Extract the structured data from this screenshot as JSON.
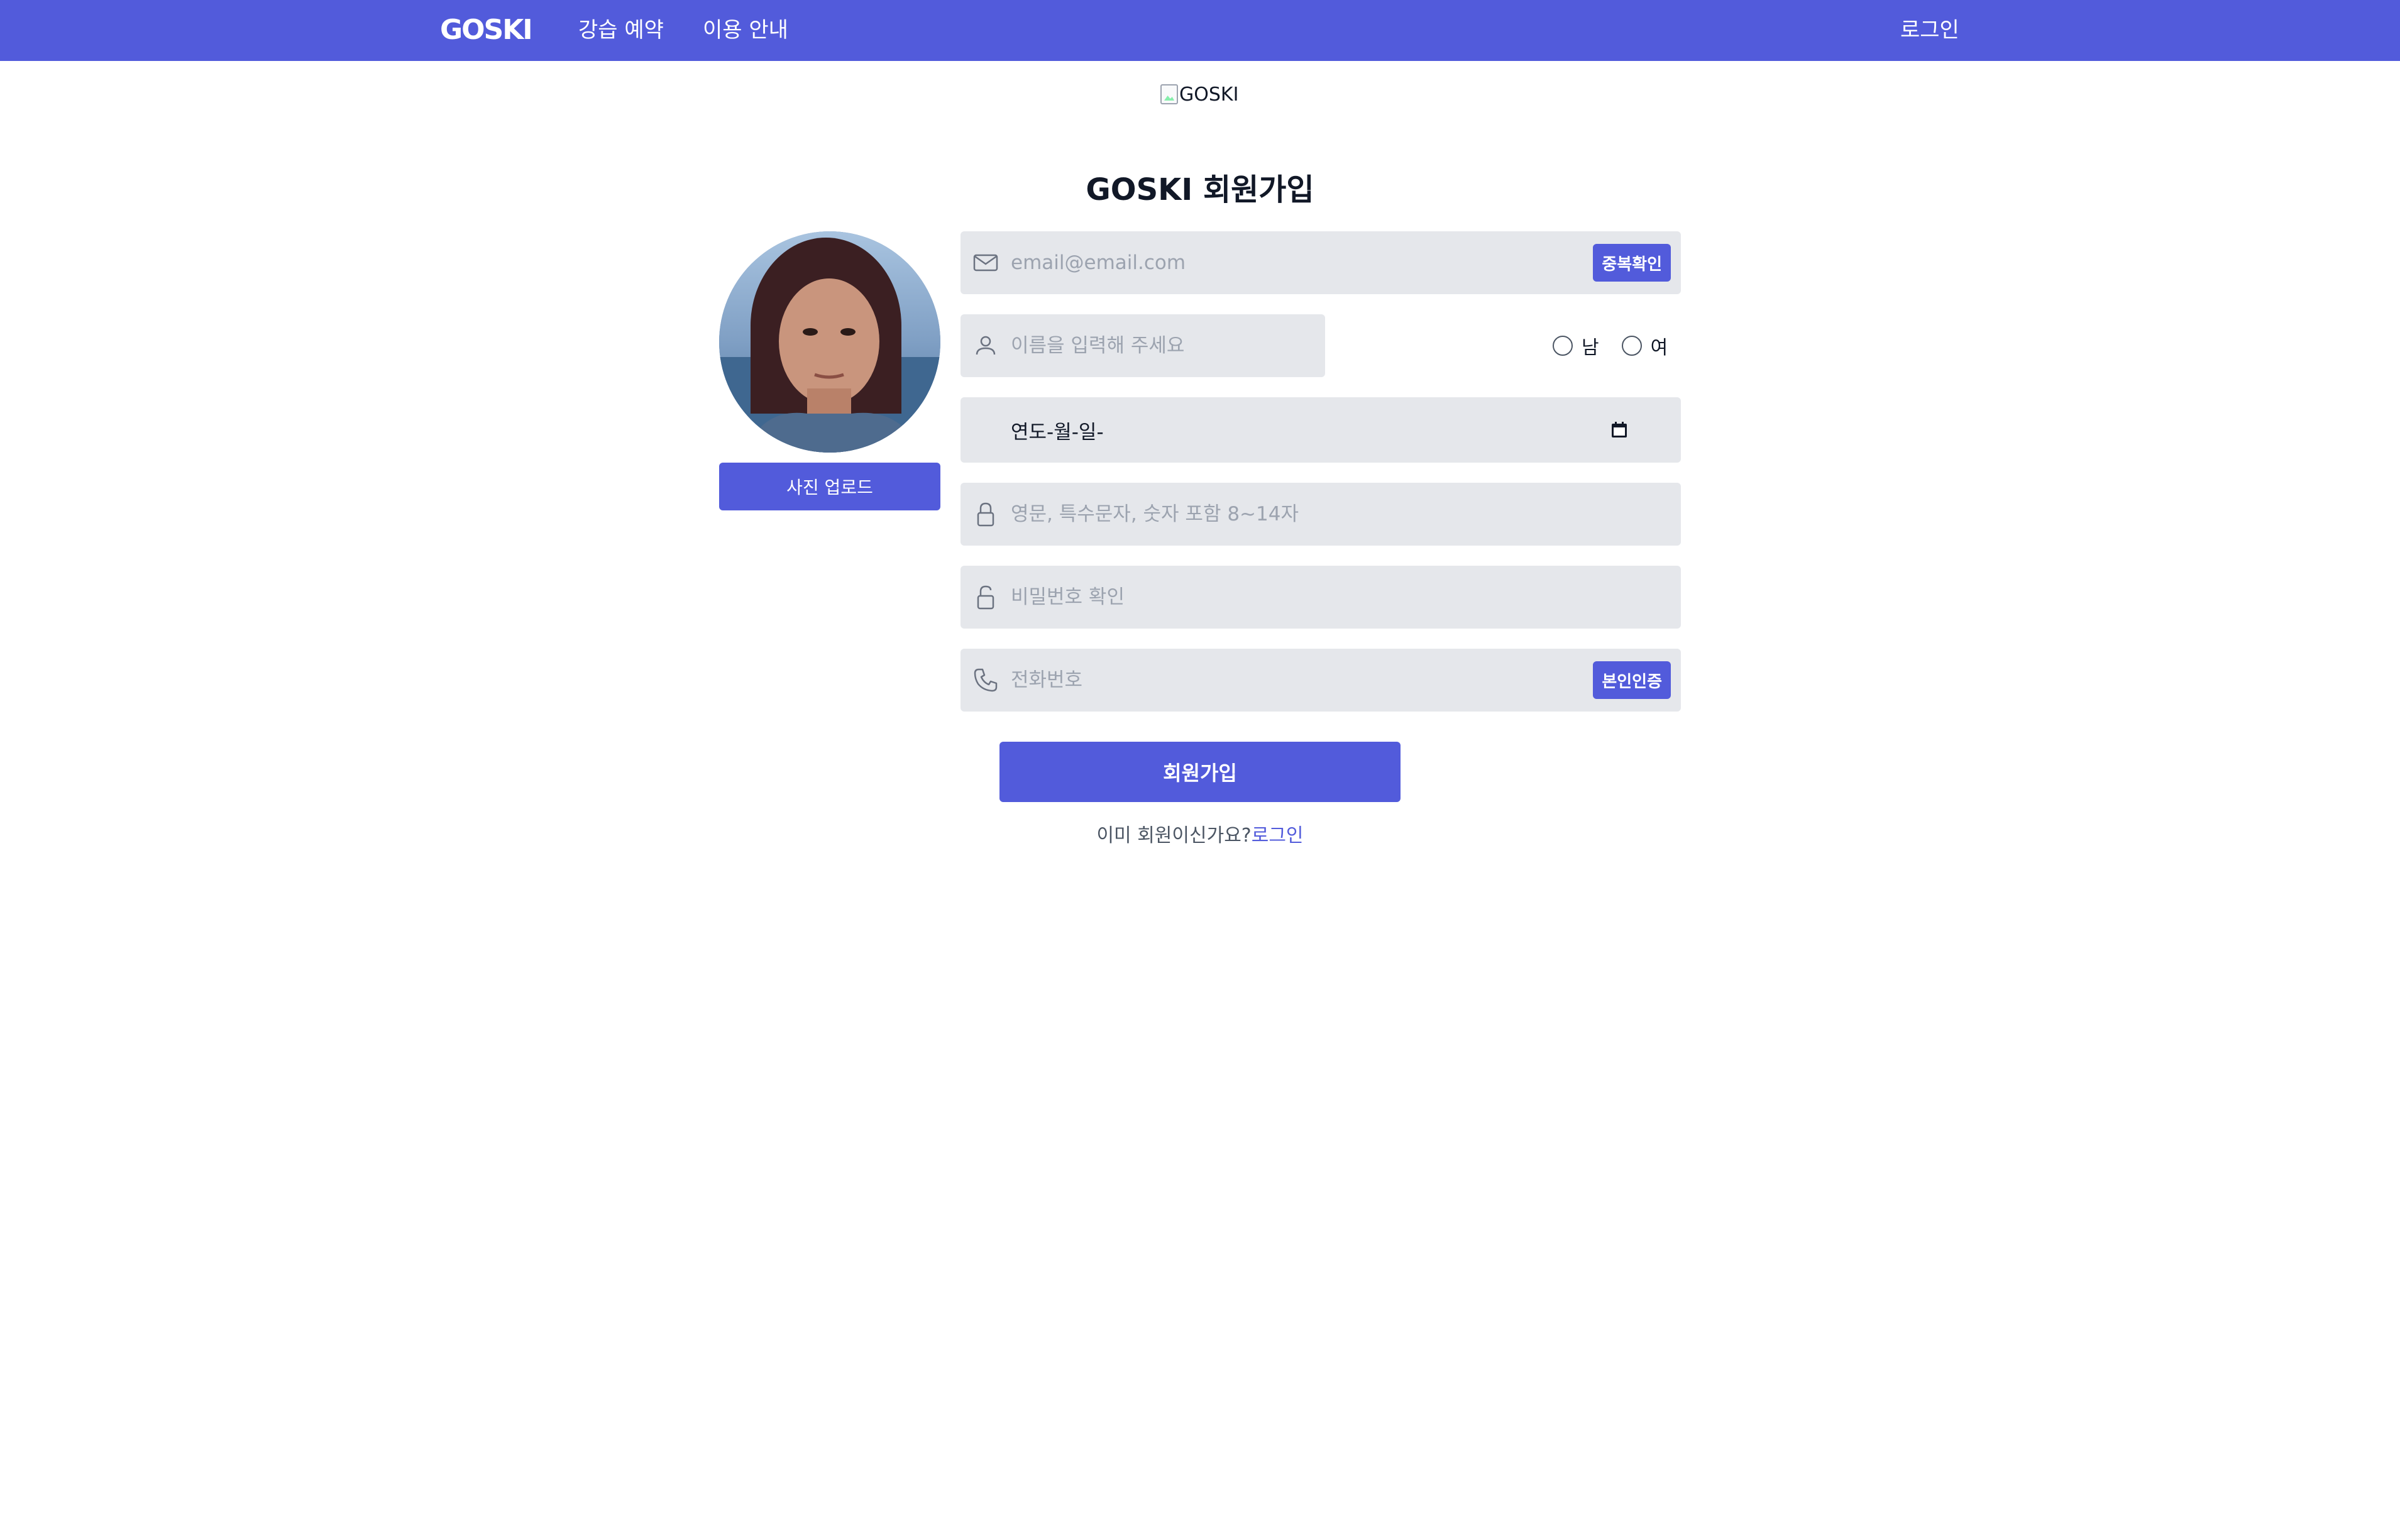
{
  "nav": {
    "brand": "GOSKI",
    "links": [
      {
        "label": "강습 예약"
      },
      {
        "label": "이용 안내"
      }
    ],
    "login": "로그인"
  },
  "logo_alt": "GOSKI",
  "title": "GOSKI 회원가입",
  "avatar": {
    "upload_label": "사진 업로드"
  },
  "form": {
    "email": {
      "placeholder": "email@email.com",
      "value": "",
      "button": "중복확인"
    },
    "name": {
      "placeholder": "이름을 입력해 주세요",
      "value": ""
    },
    "gender": {
      "options": [
        {
          "label": "남"
        },
        {
          "label": "여"
        }
      ],
      "selected": null
    },
    "birth": {
      "display": "연도-월-일-"
    },
    "password": {
      "placeholder": "영문, 특수문자, 숫자 포함 8~14자",
      "value": ""
    },
    "password_confirm": {
      "placeholder": "비밀번호 확인",
      "value": ""
    },
    "phone": {
      "placeholder": "전화번호",
      "value": "",
      "button": "본인인증"
    },
    "submit": "회원가입"
  },
  "footer": {
    "question": "이미 회원이신가요?",
    "login_link": "로그인"
  },
  "colors": {
    "accent": "#525bdb",
    "field_bg": "#e5e7eb",
    "placeholder": "#9ca3af"
  }
}
